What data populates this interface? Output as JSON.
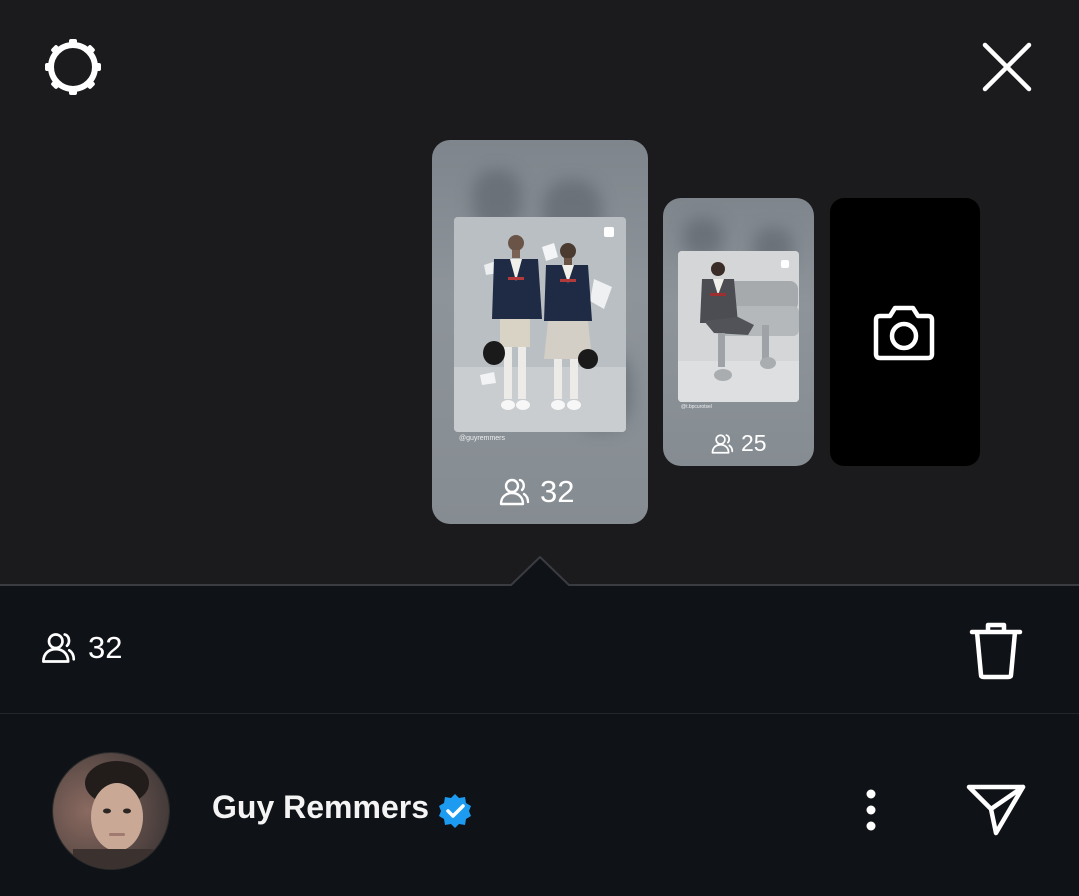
{
  "story_cards": [
    {
      "handle": "@guyremmers",
      "viewers": "32"
    },
    {
      "handle": "@t.bpcurotsel",
      "viewers": "25"
    }
  ],
  "selected_story": {
    "viewers": "32"
  },
  "profile": {
    "name": "Guy Remmers",
    "verified": true
  },
  "icons": {
    "settings": "gear-icon",
    "close": "close-icon",
    "camera": "camera-icon",
    "viewers": "viewers-icon",
    "trash": "trash-icon",
    "more": "more-vertical-icon",
    "send": "send-icon",
    "verified": "verified-badge-icon"
  },
  "colors": {
    "background": "#1b1b1d",
    "sheet": "#0f1216",
    "verified": "#1d9bf0"
  }
}
